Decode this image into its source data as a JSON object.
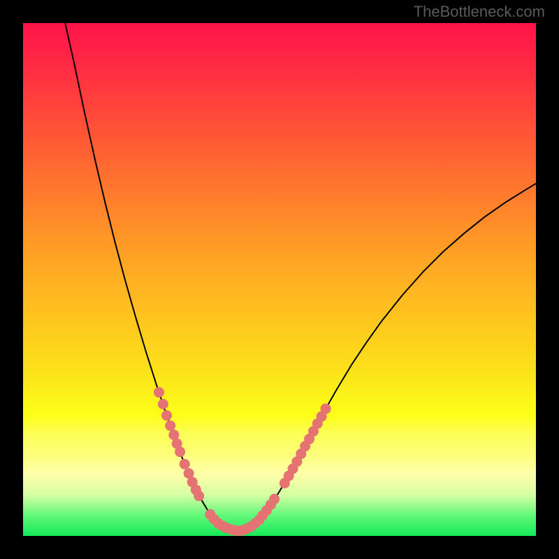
{
  "watermark": "TheBottleneck.com",
  "chart_data": {
    "type": "line",
    "title": "",
    "xlabel": "",
    "ylabel": "",
    "xlim": [
      0,
      100
    ],
    "ylim": [
      0,
      100
    ],
    "curve": {
      "name": "bottleneck-curve",
      "points": [
        {
          "x": 8.2,
          "y": 100.0
        },
        {
          "x": 10.0,
          "y": 92.0
        },
        {
          "x": 12.0,
          "y": 82.5
        },
        {
          "x": 14.0,
          "y": 73.5
        },
        {
          "x": 16.0,
          "y": 65.0
        },
        {
          "x": 18.0,
          "y": 57.0
        },
        {
          "x": 20.0,
          "y": 49.5
        },
        {
          "x": 22.0,
          "y": 42.5
        },
        {
          "x": 24.0,
          "y": 35.8
        },
        {
          "x": 26.0,
          "y": 29.5
        },
        {
          "x": 28.0,
          "y": 23.5
        },
        {
          "x": 30.0,
          "y": 18.0
        },
        {
          "x": 31.5,
          "y": 14.0
        },
        {
          "x": 33.0,
          "y": 10.5
        },
        {
          "x": 34.5,
          "y": 7.5
        },
        {
          "x": 36.0,
          "y": 5.0
        },
        {
          "x": 37.5,
          "y": 3.2
        },
        {
          "x": 39.0,
          "y": 2.0
        },
        {
          "x": 40.5,
          "y": 1.3
        },
        {
          "x": 42.0,
          "y": 1.0
        },
        {
          "x": 43.5,
          "y": 1.3
        },
        {
          "x": 45.0,
          "y": 2.2
        },
        {
          "x": 46.5,
          "y": 3.7
        },
        {
          "x": 48.0,
          "y": 5.7
        },
        {
          "x": 50.0,
          "y": 8.7
        },
        {
          "x": 52.0,
          "y": 12.0
        },
        {
          "x": 54.0,
          "y": 15.6
        },
        {
          "x": 56.0,
          "y": 19.3
        },
        {
          "x": 58.0,
          "y": 23.0
        },
        {
          "x": 61.0,
          "y": 28.3
        },
        {
          "x": 64.0,
          "y": 33.3
        },
        {
          "x": 67.0,
          "y": 37.8
        },
        {
          "x": 70.0,
          "y": 42.0
        },
        {
          "x": 74.0,
          "y": 47.0
        },
        {
          "x": 78.0,
          "y": 51.5
        },
        {
          "x": 82.0,
          "y": 55.5
        },
        {
          "x": 86.0,
          "y": 59.0
        },
        {
          "x": 90.0,
          "y": 62.2
        },
        {
          "x": 94.0,
          "y": 65.0
        },
        {
          "x": 98.0,
          "y": 67.5
        },
        {
          "x": 100.0,
          "y": 68.7
        }
      ]
    },
    "markers": {
      "name": "highlighted-points",
      "color": "#e57373",
      "points": [
        {
          "x": 26.5,
          "y": 28.0
        },
        {
          "x": 27.3,
          "y": 25.7
        },
        {
          "x": 28.0,
          "y": 23.5
        },
        {
          "x": 28.7,
          "y": 21.5
        },
        {
          "x": 29.4,
          "y": 19.7
        },
        {
          "x": 30.0,
          "y": 18.0
        },
        {
          "x": 30.6,
          "y": 16.4
        },
        {
          "x": 31.5,
          "y": 14.0
        },
        {
          "x": 32.3,
          "y": 12.2
        },
        {
          "x": 33.0,
          "y": 10.5
        },
        {
          "x": 33.7,
          "y": 9.0
        },
        {
          "x": 34.3,
          "y": 7.8
        },
        {
          "x": 36.5,
          "y": 4.2
        },
        {
          "x": 37.2,
          "y": 3.3
        },
        {
          "x": 38.0,
          "y": 2.5
        },
        {
          "x": 38.8,
          "y": 2.0
        },
        {
          "x": 39.6,
          "y": 1.6
        },
        {
          "x": 40.4,
          "y": 1.3
        },
        {
          "x": 41.2,
          "y": 1.1
        },
        {
          "x": 42.0,
          "y": 1.0
        },
        {
          "x": 42.8,
          "y": 1.1
        },
        {
          "x": 43.6,
          "y": 1.4
        },
        {
          "x": 44.4,
          "y": 1.8
        },
        {
          "x": 45.2,
          "y": 2.4
        },
        {
          "x": 46.0,
          "y": 3.1
        },
        {
          "x": 46.7,
          "y": 4.0
        },
        {
          "x": 47.5,
          "y": 5.0
        },
        {
          "x": 48.3,
          "y": 6.1
        },
        {
          "x": 49.0,
          "y": 7.2
        },
        {
          "x": 51.0,
          "y": 10.3
        },
        {
          "x": 51.8,
          "y": 11.7
        },
        {
          "x": 52.6,
          "y": 13.1
        },
        {
          "x": 53.4,
          "y": 14.5
        },
        {
          "x": 54.2,
          "y": 16.0
        },
        {
          "x": 55.0,
          "y": 17.5
        },
        {
          "x": 55.8,
          "y": 18.9
        },
        {
          "x": 56.6,
          "y": 20.4
        },
        {
          "x": 57.4,
          "y": 21.9
        },
        {
          "x": 58.2,
          "y": 23.3
        },
        {
          "x": 59.0,
          "y": 24.8
        }
      ]
    }
  }
}
